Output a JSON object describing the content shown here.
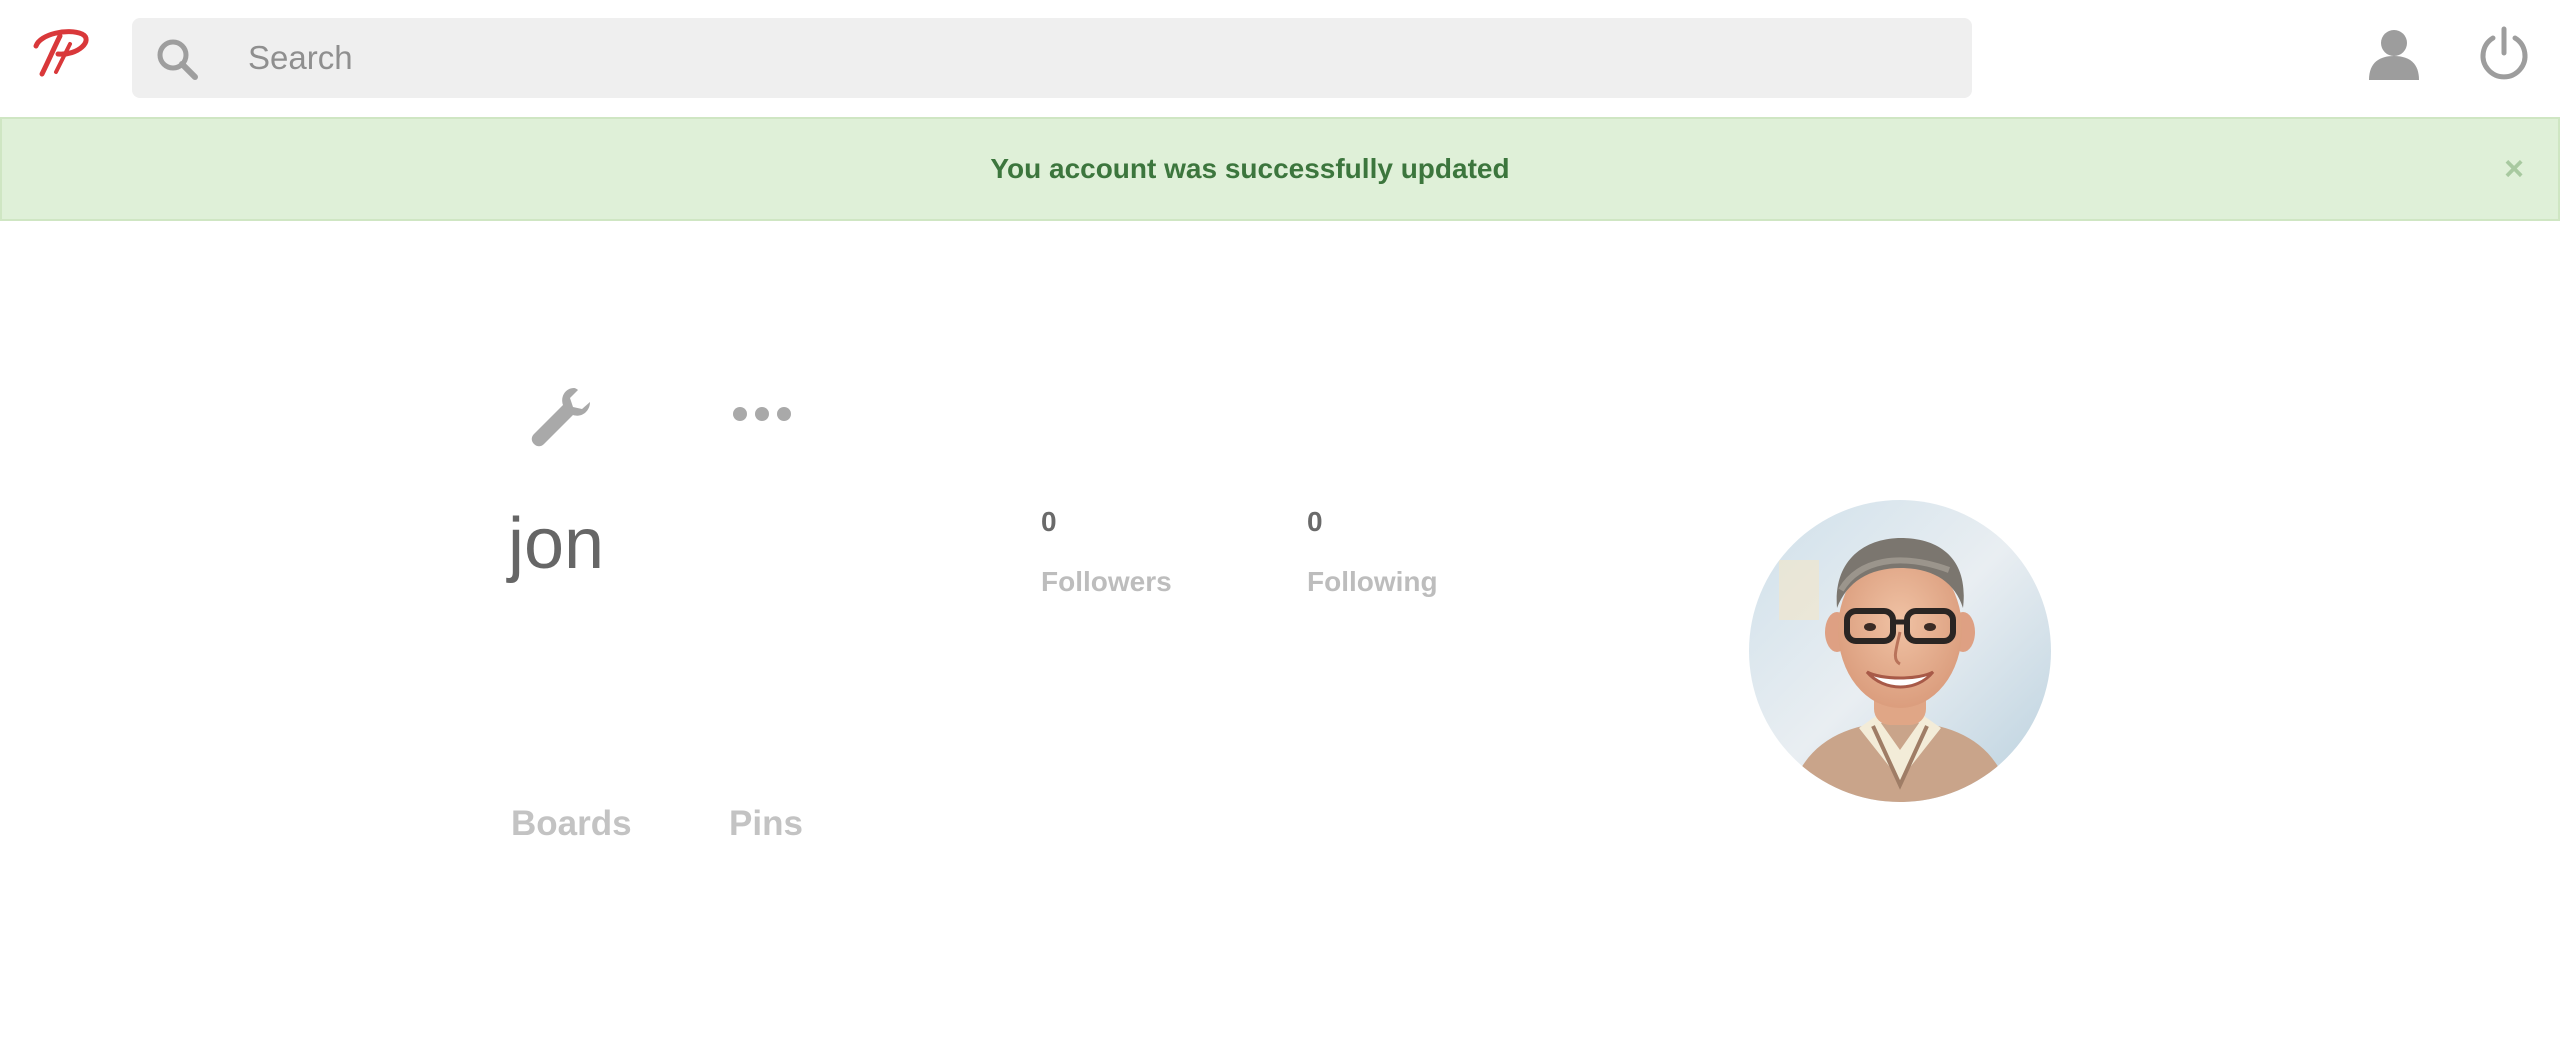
{
  "header": {
    "logo_icon": "pinterest-logo-icon",
    "search": {
      "placeholder": "Search",
      "value": ""
    },
    "user_icon": "user-icon",
    "power_icon": "power-icon"
  },
  "alert": {
    "message": "You account was successfully updated",
    "close_label": "×",
    "colors": {
      "background": "#dff0d8",
      "text": "#3c763d"
    }
  },
  "profile": {
    "username": "jon",
    "actions": [
      "wrench-icon",
      "more-icon"
    ],
    "stats": {
      "followers": {
        "count": "0",
        "label": "Followers"
      },
      "following": {
        "count": "0",
        "label": "Following"
      }
    },
    "tabs": [
      {
        "label": "Boards"
      },
      {
        "label": "Pins"
      }
    ]
  },
  "colors": {
    "brand": "#d9383a"
  }
}
